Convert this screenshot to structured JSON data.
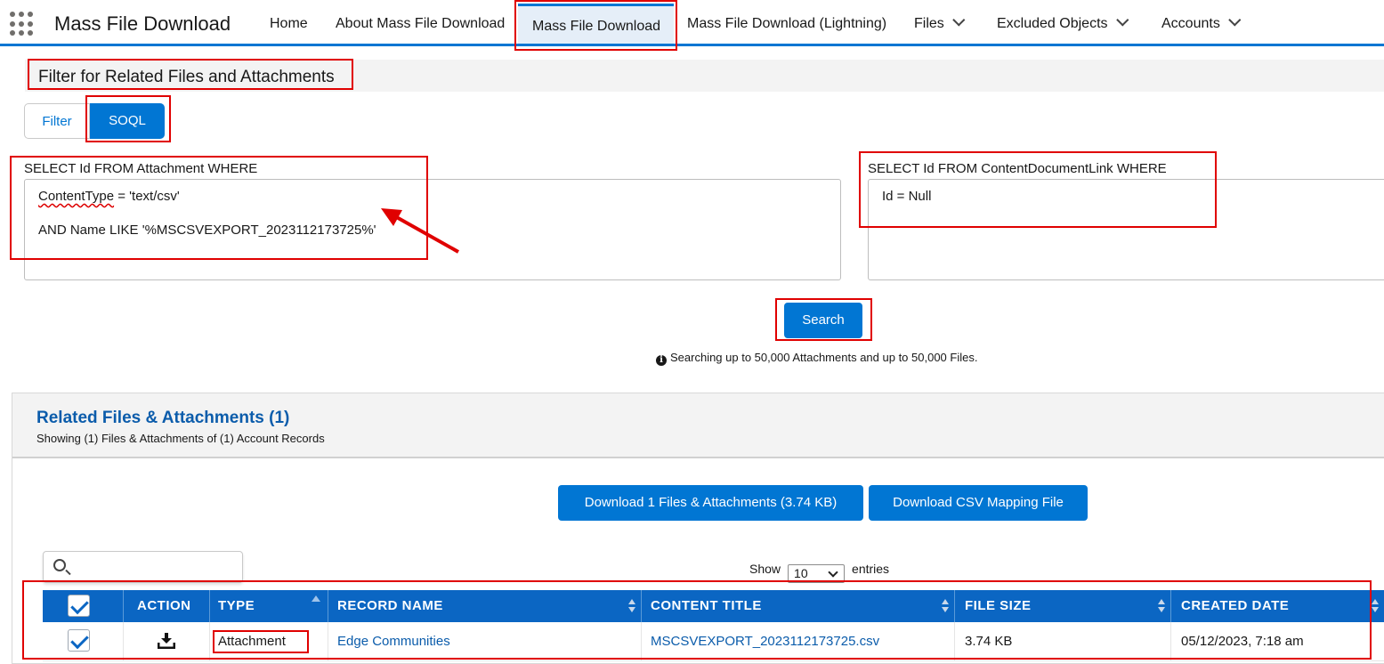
{
  "app": {
    "name": "Mass File Download"
  },
  "nav": {
    "home": "Home",
    "about": "About Mass File Download",
    "active": "Mass File Download",
    "lightning": "Mass File Download (Lightning)",
    "files": "Files",
    "excluded": "Excluded Objects",
    "accounts": "Accounts"
  },
  "filter": {
    "title": "Filter for Related Files and Attachments",
    "tab_filter": "Filter",
    "tab_soql": "SOQL"
  },
  "query_attachment": {
    "label": "SELECT Id FROM Attachment WHERE",
    "line1_a": "ContentType",
    "line1_b": " = 'text/csv'",
    "line2": "AND Name LIKE '%MSCSVEXPORT_2023112173725%'"
  },
  "query_cdl": {
    "label": "SELECT Id FROM ContentDocumentLink WHERE",
    "line1": "Id = Null"
  },
  "search": {
    "button": "Search",
    "info": "Searching up to 50,000 Attachments and up to 50,000 Files."
  },
  "results": {
    "title": "Related Files & Attachments (1)",
    "subtitle": "Showing (1) Files & Attachments of (1) Account Records",
    "download_button": "Download 1 Files & Attachments (3.74 KB)",
    "csv_button": "Download CSV Mapping File",
    "show_label": "Show",
    "show_value": "10",
    "entries_label": "entries"
  },
  "table": {
    "columns": {
      "action": "ACTION",
      "type": "TYPE",
      "record_name": "RECORD NAME",
      "content_title": "CONTENT TITLE",
      "file_size": "FILE SIZE",
      "created_date": "CREATED DATE"
    },
    "rows": [
      {
        "type": "Attachment",
        "record_name": "Edge Communities",
        "content_title": "MSCSVEXPORT_2023112173725.csv",
        "file_size": "3.74 KB",
        "created_date": "05/12/2023, 7:18 am"
      }
    ]
  },
  "colors": {
    "brand": "#0176d3",
    "table_header": "#0b66c3",
    "link": "#0b5cab",
    "annotation": "#e00000"
  }
}
